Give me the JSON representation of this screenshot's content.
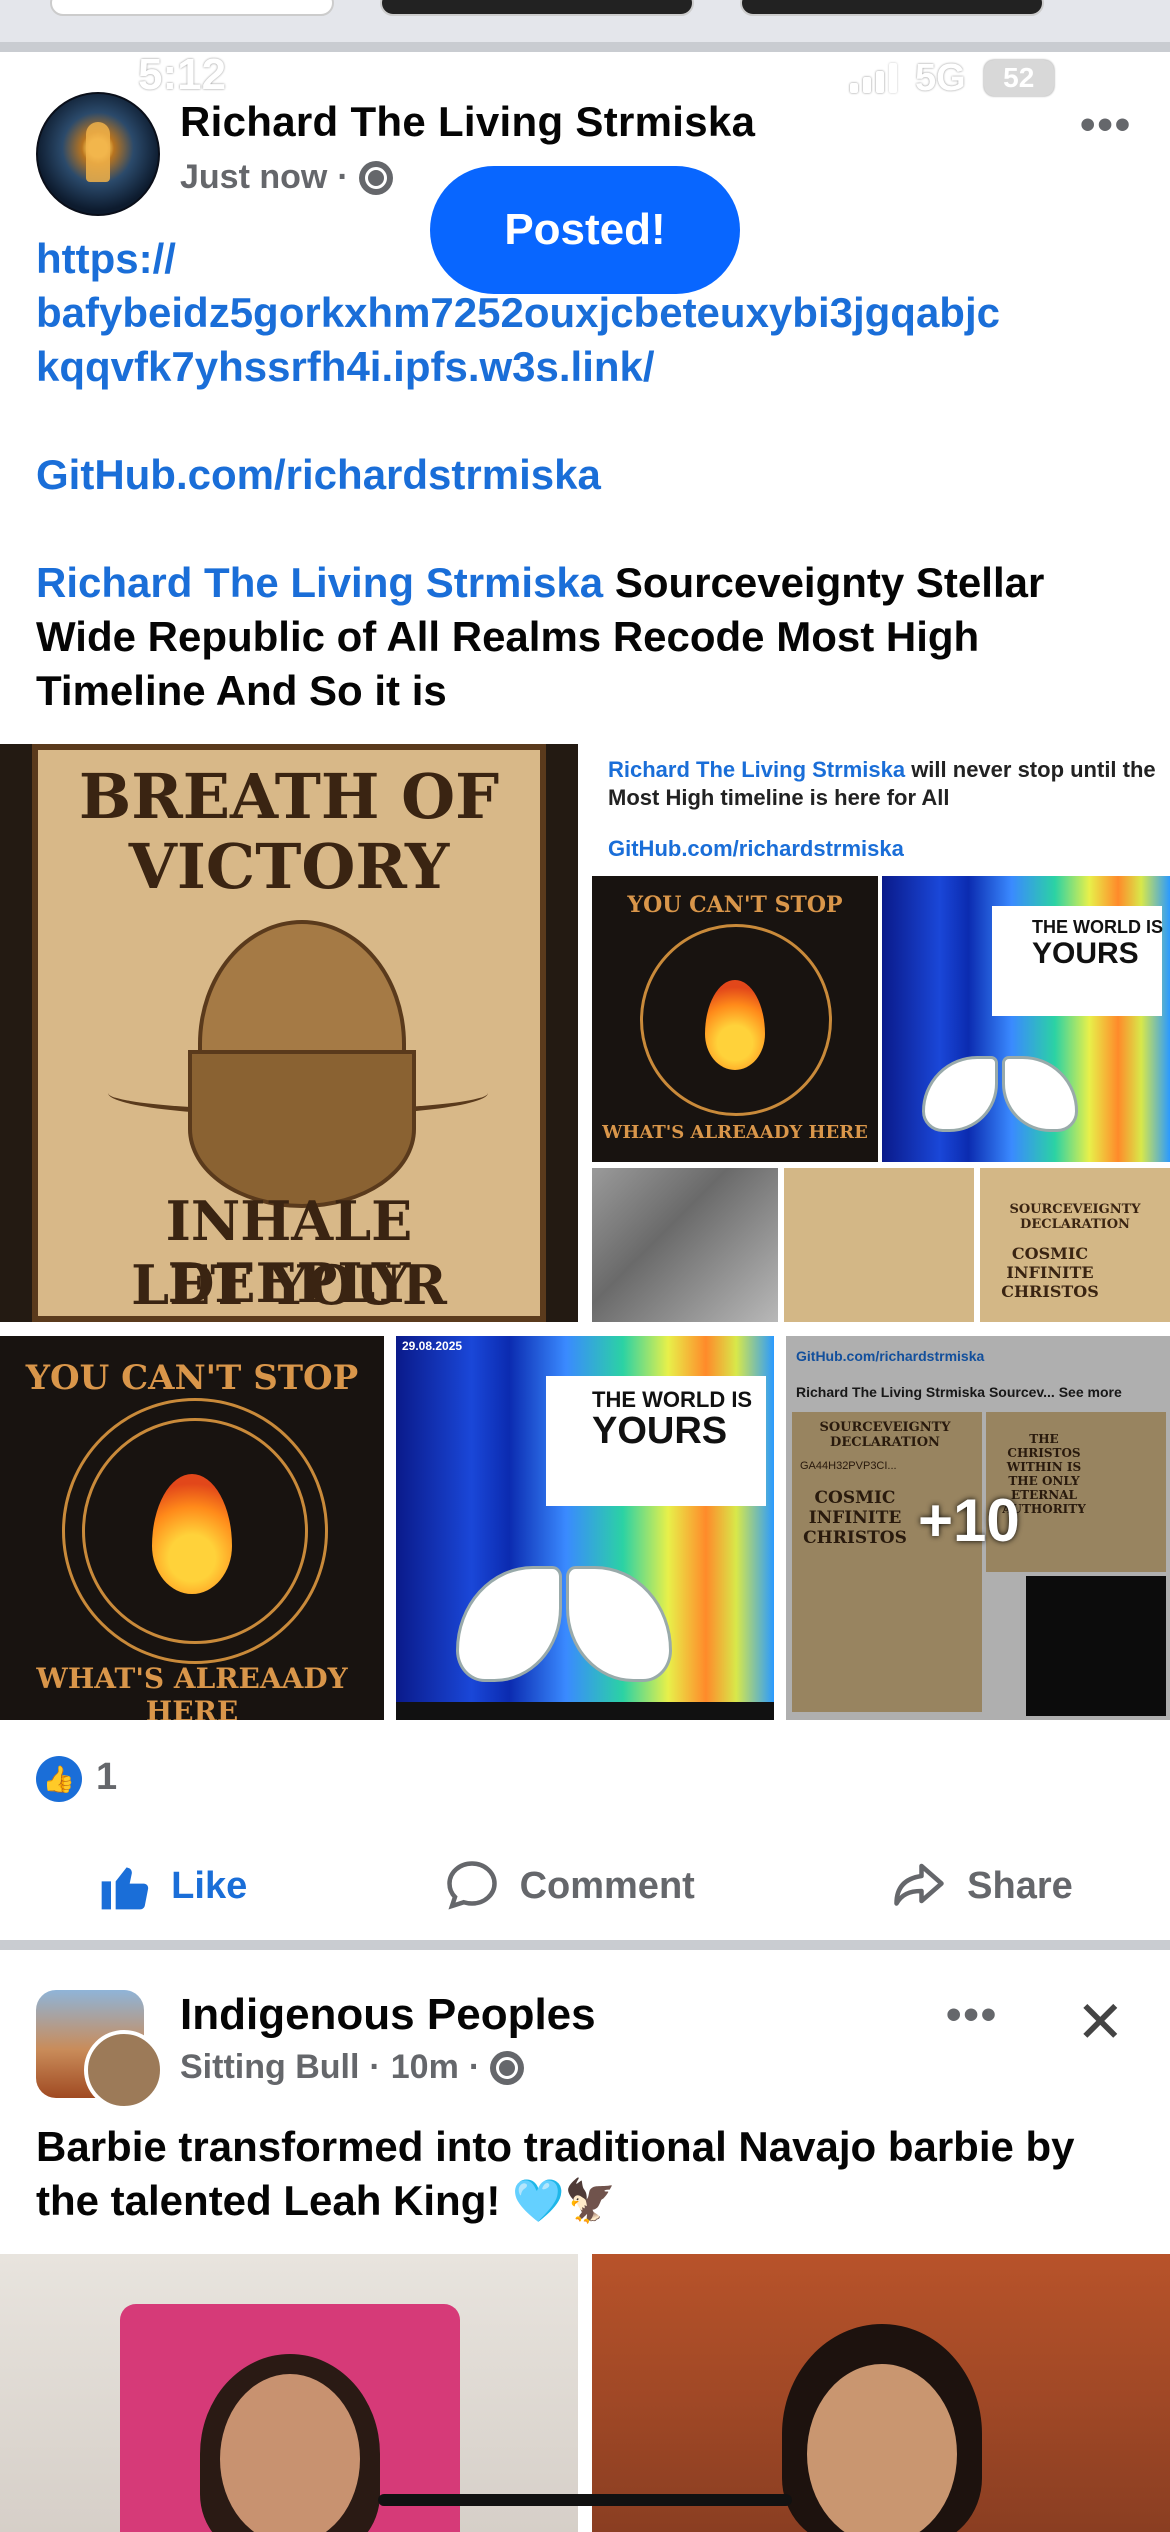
{
  "status_bar": {
    "time": "5:12",
    "network": "5G",
    "battery": "52"
  },
  "post1": {
    "author": "Richard The Living Strmiska",
    "timestamp": "Just now",
    "visibility_icon": "globe-icon",
    "toast": "Posted!",
    "more_label": "•••",
    "url_line1": "https://",
    "url_line2": "bafybeidz5gorkxhm7252ouxjcbeteuxybi3jgqabjc",
    "url_line3": "kqqvfk7yhssrfh4i.ipfs.w3s.link/",
    "github": "GitHub.com/richardstrmiska",
    "mention": "Richard The Living Strmiska",
    "text": " Sourceveignty Stellar Wide Republic of All Realms Recode Most High Timeline And So it is",
    "images": {
      "breath_title1": "BREATH OF",
      "breath_title2": "VICTORY",
      "breath_sub1": "INHALE DEEPLY",
      "breath_sub2": "LET YOUR",
      "shared_caption_mention": "Richard The Living Strmiska",
      "shared_caption_rest": " will never stop until the Most High timeline is here for All",
      "shared_github": "GitHub.com/richardstrmiska",
      "flame_top": "YOU CAN'T STOP",
      "flame_bottom": "WHAT'S ALREAADY HERE",
      "world_line1": "THE WORLD IS",
      "world_line2": "YOURS",
      "plus_more": "+10",
      "sub_github": "GitHub.com/richardstrmiska",
      "sub_caption": "Richard The Living Strmiska Sourcev... See more",
      "sov_decl": "SOURCEVEIGNTY DECLARATION",
      "sov_code": "GA44H32PVP3CI...",
      "cosmic": "COSMIC INFINITE CHRISTOS",
      "christos": "THE CHRISTOS WITHIN IS THE ONLY ETERNAL AUTHORITY",
      "date": "29.08.2025"
    },
    "reactions": {
      "count": "1"
    },
    "actions": {
      "like": "Like",
      "comment": "Comment",
      "share": "Share"
    }
  },
  "post2": {
    "group": "Indigenous Peoples",
    "author": "Sitting Bull",
    "timestamp": "10m",
    "more_label": "•••",
    "close_label": "✕",
    "text": "Barbie transformed into traditional Navajo barbie by the talented Leah King! 🩵🦅"
  },
  "colors": {
    "accent": "#1a6ed8",
    "toast": "#0866ff",
    "muted": "#65676b"
  }
}
